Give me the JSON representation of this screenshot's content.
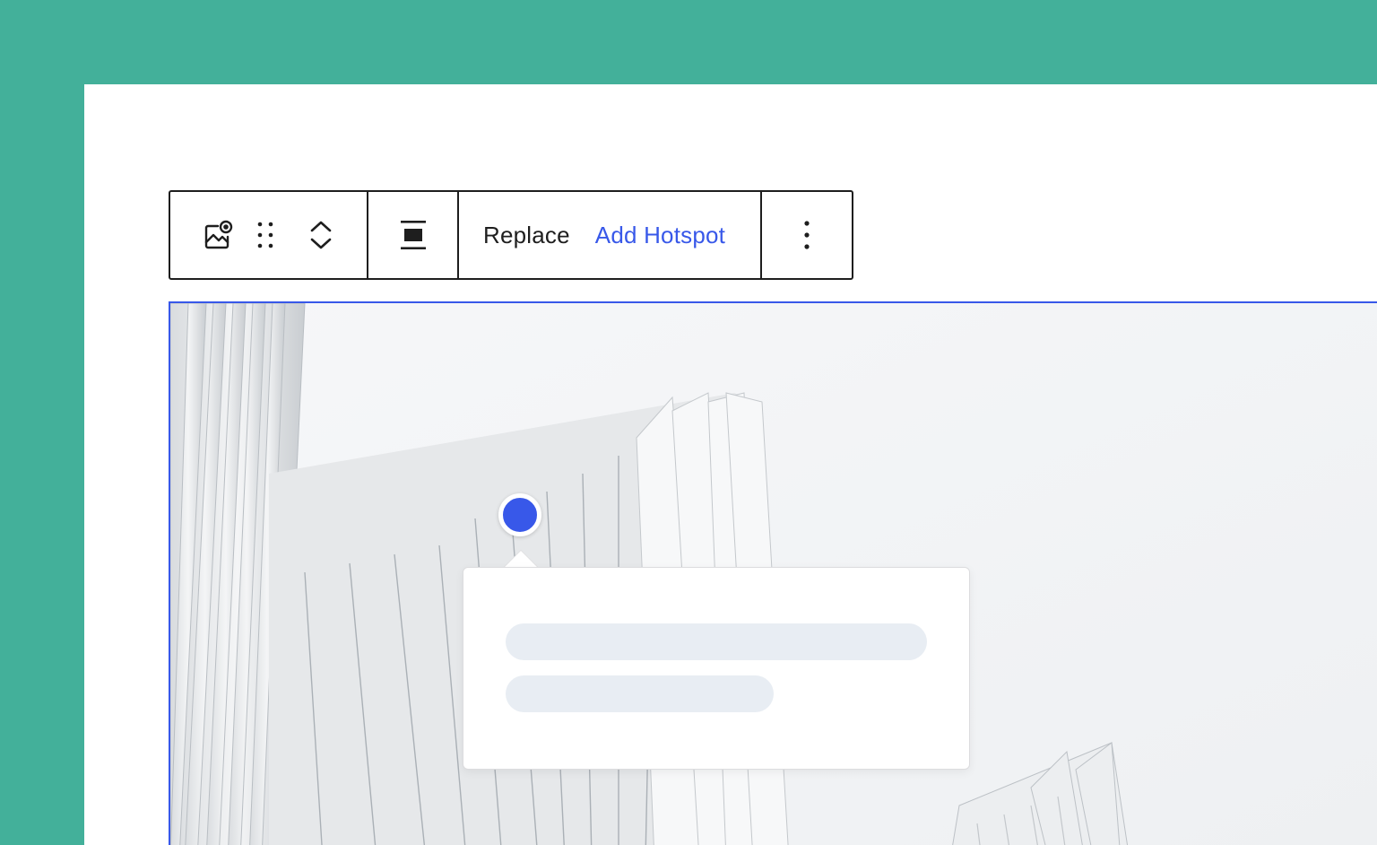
{
  "toolbar": {
    "block_icon": "image-hotspot-icon",
    "drag_icon": "drag-handle-icon",
    "move_up_icon": "chevron-up-icon",
    "move_down_icon": "chevron-down-icon",
    "align_icon": "align-center-icon",
    "replace_label": "Replace",
    "add_hotspot_label": "Add Hotspot",
    "more_icon": "more-vertical-icon"
  },
  "colors": {
    "background": "#43b09a",
    "accent": "#3858e9",
    "text": "#1e1e1e",
    "skeleton": "#e8edf3"
  }
}
